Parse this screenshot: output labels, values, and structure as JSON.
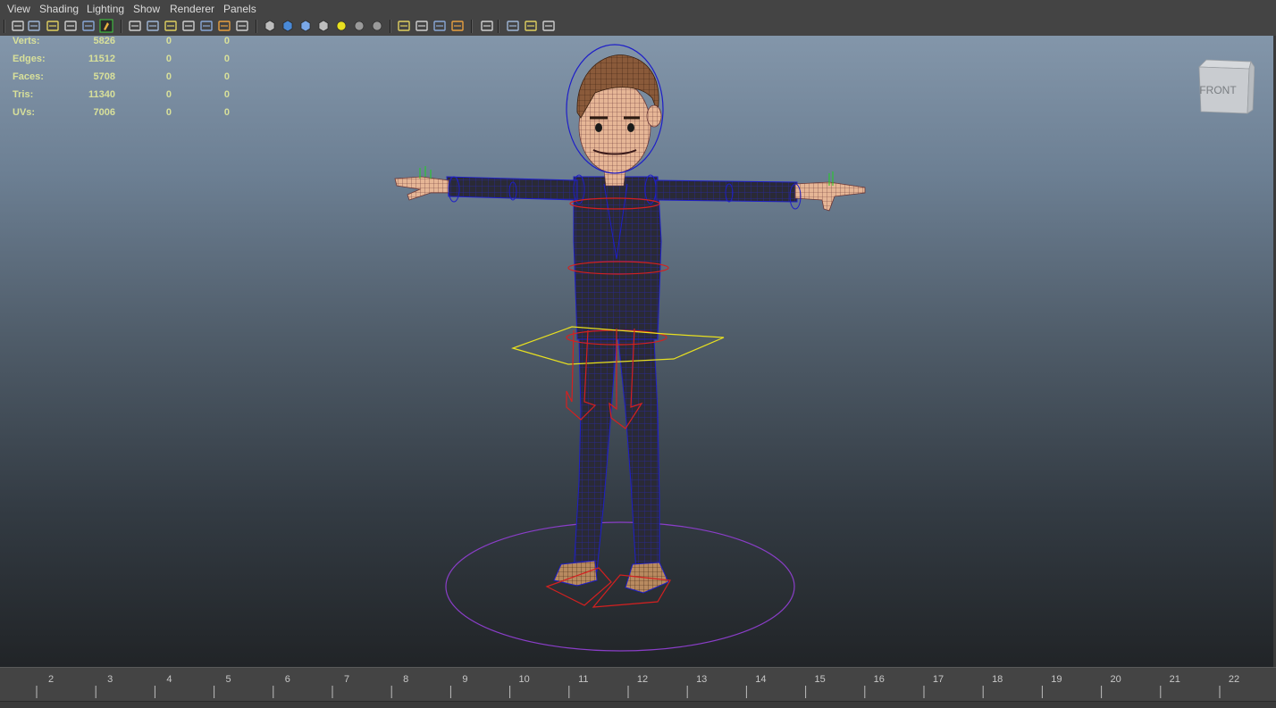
{
  "menu": [
    "View",
    "Shading",
    "Lighting",
    "Show",
    "Renderer",
    "Panels"
  ],
  "toolbar_icons": [
    "camera-attributes-icon",
    "camera-tools-icon",
    "bookmark-icon",
    "image-plane-icon",
    "2d-pan-zoom-icon",
    "grease-pencil-icon",
    "grid-icon",
    "film-gate-icon",
    "resolution-gate-icon",
    "gate-mask-icon",
    "field-chart-icon",
    "safe-action-icon",
    "safe-title-icon",
    "wireframe-icon",
    "smooth-shade-icon",
    "shaded-wireframe-icon",
    "textured-icon",
    "default-lighting-icon",
    "shadows-icon",
    "screen-space-ao-icon",
    "motion-blur-icon",
    "antialiasing-icon",
    "depth-of-field-icon",
    "x-ray-icon",
    "x-ray-joints-icon",
    "backface-culling-icon",
    "isolate-select-icon",
    "xray-active-icon",
    "single-view-icon",
    "four-view-icon",
    "node-editor-icon"
  ],
  "hud": {
    "rows": [
      {
        "label": "Verts:",
        "v1": "5826",
        "v2": "0",
        "v3": "0"
      },
      {
        "label": "Edges:",
        "v1": "11512",
        "v2": "0",
        "v3": "0"
      },
      {
        "label": "Faces:",
        "v1": "5708",
        "v2": "0",
        "v3": "0"
      },
      {
        "label": "Tris:",
        "v1": "11340",
        "v2": "0",
        "v3": "0"
      },
      {
        "label": "UVs:",
        "v1": "7006",
        "v2": "0",
        "v3": "0"
      }
    ]
  },
  "viewcube": {
    "label": "FRONT"
  },
  "timeline": {
    "frames": [
      "2",
      "3",
      "4",
      "5",
      "6",
      "7",
      "8",
      "9",
      "10",
      "11",
      "12",
      "13",
      "14",
      "15",
      "16",
      "17",
      "18",
      "19",
      "20",
      "21",
      "22"
    ]
  },
  "colors": {
    "hud_text": "#d8e09a",
    "wire_blue": "#1e1ec8",
    "control_red": "#d42020",
    "control_yellow": "#e8e020",
    "control_purple": "#8a3ec8",
    "skin": "#e8b898"
  }
}
